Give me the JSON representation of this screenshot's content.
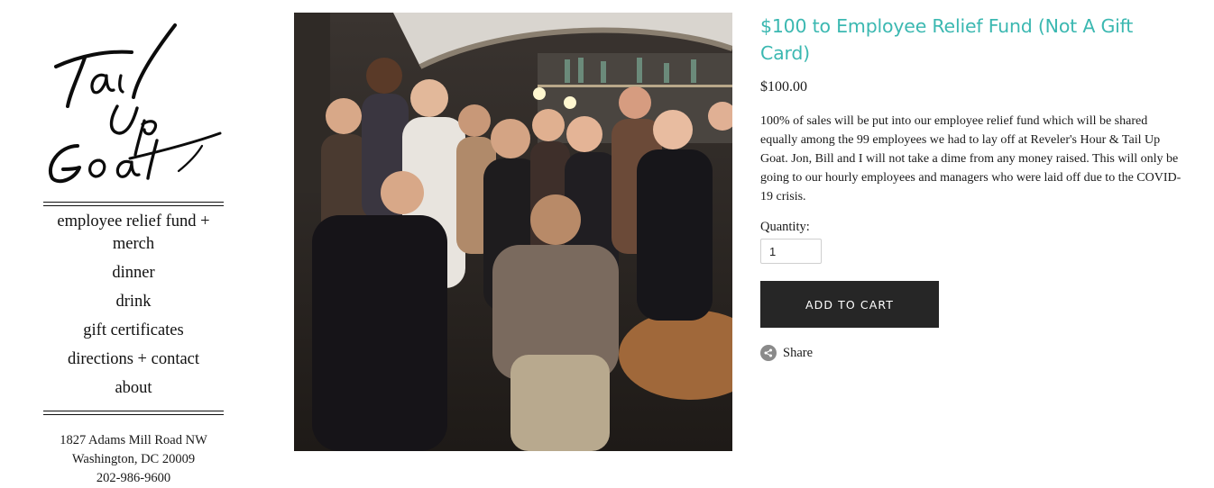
{
  "logo": {
    "text": "Tail Up Goat"
  },
  "nav": {
    "items": [
      {
        "label": "employee relief fund + merch"
      },
      {
        "label": "dinner"
      },
      {
        "label": "drink"
      },
      {
        "label": "gift certificates"
      },
      {
        "label": "directions + contact"
      },
      {
        "label": "about"
      }
    ]
  },
  "address": {
    "street": "1827 Adams Mill Road NW",
    "city": "Washington, DC 20009",
    "phone": "202-986-9600"
  },
  "product": {
    "image_icon": "staff-group-photo",
    "title": "$100 to Employee Relief Fund (Not A Gift Card)",
    "price": "$100.00",
    "description": "100% of sales will be put into our employee relief fund which will be shared equally among the 99 employees we had to lay off at Reveler's Hour & Tail Up Goat.  Jon, Bill and I will not take a dime from any money raised.  This will only be going to our hourly employees and managers who were laid off due to the COVID-19 crisis.",
    "quantity_label": "Quantity:",
    "quantity_value": "1",
    "add_to_cart_label": "ADD TO CART",
    "share_label": "Share"
  },
  "colors": {
    "title_accent": "#3bb8b1",
    "button_bg": "#262626",
    "button_text": "#ffffff"
  }
}
